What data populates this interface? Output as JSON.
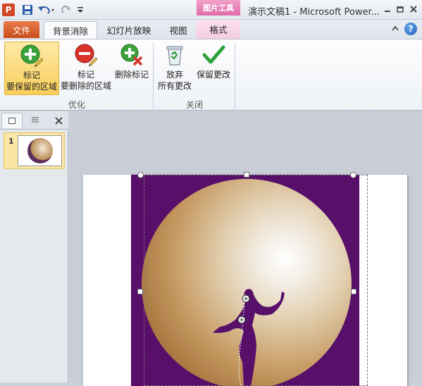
{
  "app": {
    "icon_letter": "P",
    "window_title": "演示文稿1 - Microsoft Power...",
    "context_tab_group": "图片工具"
  },
  "tabs": {
    "file": "文件",
    "background_removal": "背景消除",
    "slideshow": "幻灯片放映",
    "view": "视图",
    "format": "格式"
  },
  "ribbon": {
    "mark_keep": {
      "line1": "标记",
      "line2": "要保留的区域"
    },
    "mark_remove": {
      "line1": "标记",
      "line2": "要删除的区域"
    },
    "delete_mark": "删除标记",
    "discard": {
      "line1": "放弃",
      "line2": "所有更改"
    },
    "keep_changes": "保留更改",
    "group_refine": "优化",
    "group_close": "关闭"
  },
  "slide_pane": {
    "slide_number": "1"
  },
  "colors": {
    "file_tab": "#c94d1c",
    "context_tab": "#e06aa8",
    "removal_overlay": "#570f6a",
    "selected_button": "#f8cf5a"
  },
  "icons": [
    "save-icon",
    "undo-icon",
    "redo-icon",
    "customize-arrow-icon",
    "minimize-icon",
    "restore-icon",
    "close-icon",
    "ribbon-collapse-icon",
    "help-icon",
    "plus-pencil-icon",
    "minus-pencil-icon",
    "delete-mark-icon",
    "recycle-bin-icon",
    "checkmark-icon",
    "slides-tab-icon",
    "outline-tab-icon",
    "pane-close-icon"
  ]
}
